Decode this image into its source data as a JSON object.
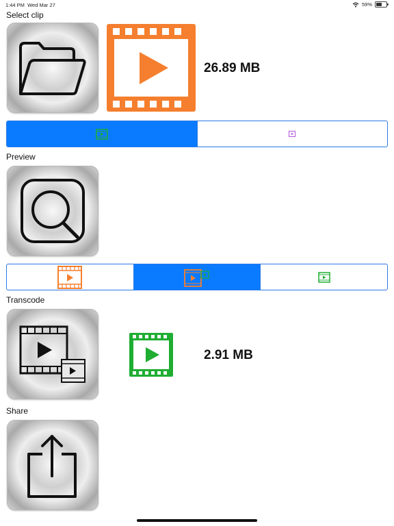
{
  "status_bar": {
    "time": "1:44 PM",
    "date": "Wed Mar 27",
    "battery": "59%",
    "battery_level": 0.59
  },
  "sections": {
    "select": {
      "label": "Select clip",
      "file_size": "26.89 MB"
    },
    "preview": {
      "label": "Preview"
    },
    "transcode": {
      "label": "Transcode",
      "file_size": "2.91 MB"
    },
    "share": {
      "label": "Share"
    }
  },
  "select_mode": {
    "selected_index": 0,
    "options": [
      "movie-icon-green",
      "movie-icon-purple"
    ]
  },
  "preview_mode": {
    "selected_index": 1,
    "options": [
      "movie-icon-orange",
      "movie-compare-icon",
      "movie-icon-green"
    ]
  },
  "icons": {
    "select_clip": "folder-open-icon",
    "preview": "search-icon",
    "transcode": "transcode-movie-icon",
    "share": "share-icon"
  },
  "colors": {
    "accent": "#0a7bff",
    "orange": "#f57f2e",
    "green": "#1fad32",
    "purple": "#b454d8"
  }
}
